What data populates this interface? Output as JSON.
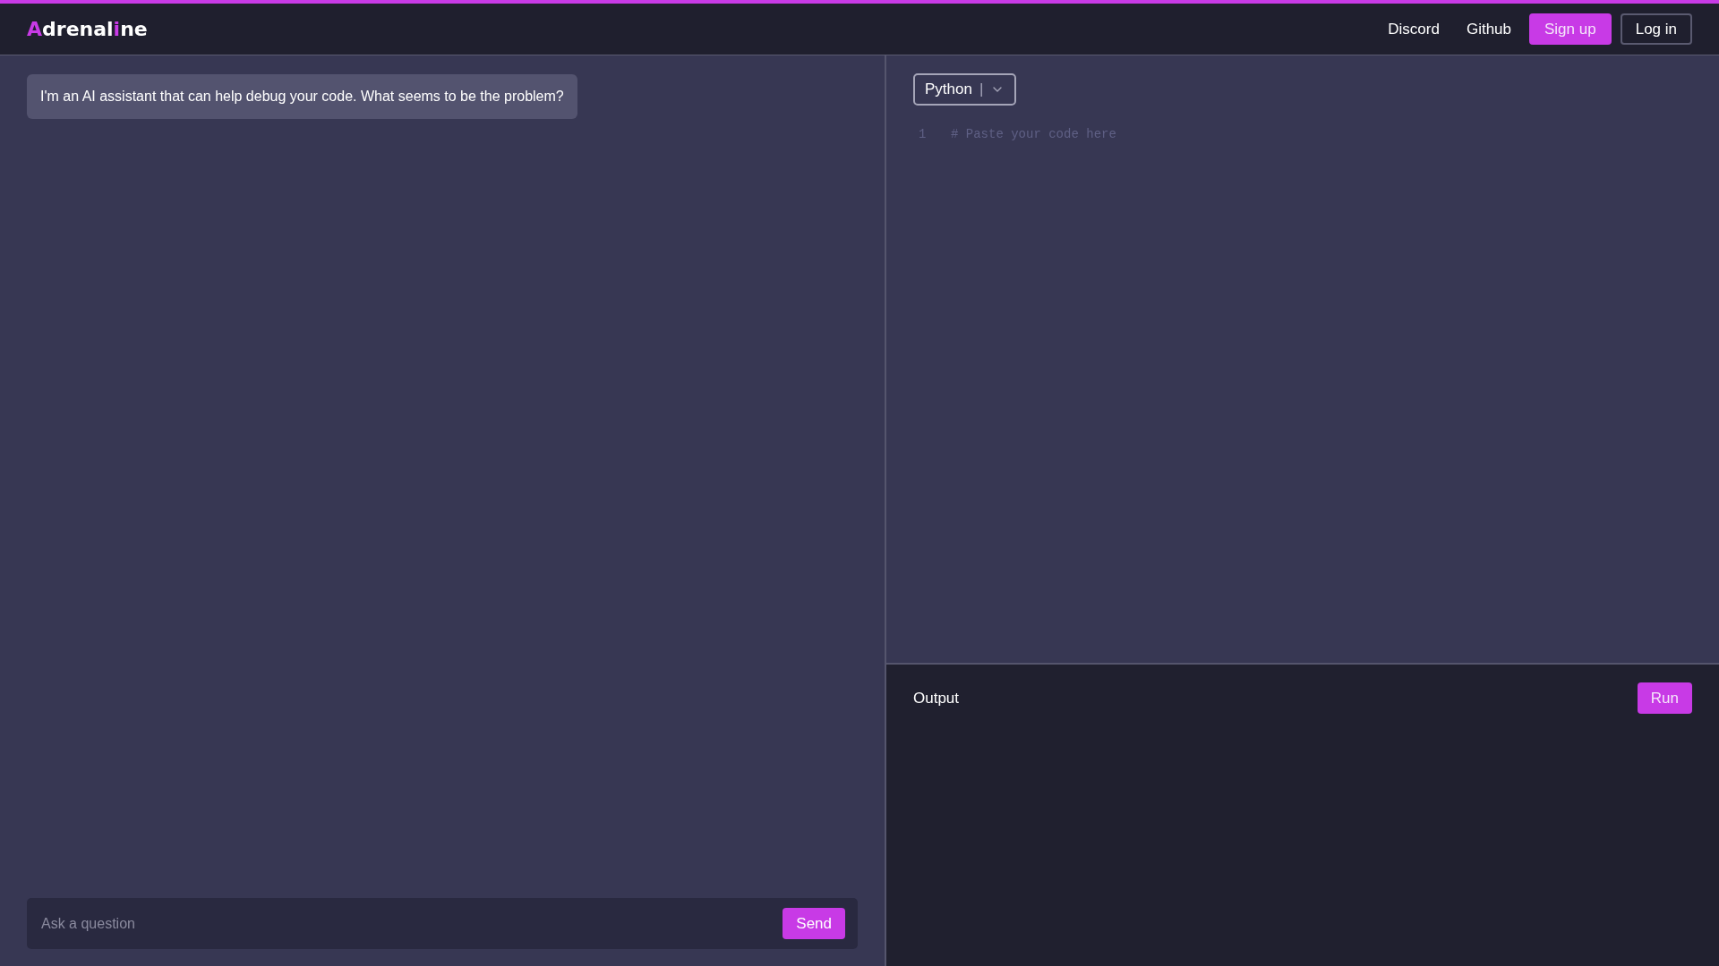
{
  "header": {
    "logo": [
      {
        "text": "A",
        "highlighted": true
      },
      {
        "text": "drenal",
        "highlighted": false
      },
      {
        "text": "i",
        "highlighted": true
      },
      {
        "text": "ne",
        "highlighted": false
      }
    ],
    "links": [
      "Discord",
      "Github"
    ],
    "buttons": [
      {
        "label": "Sign up",
        "kind": "primary"
      },
      {
        "label": "Log in",
        "kind": "outline"
      }
    ]
  },
  "chat": {
    "messages": [
      {
        "text": "I'm an AI assistant that can help debug your code. What seems to be the problem?"
      }
    ],
    "input": {
      "placeholder": "Ask a question"
    },
    "send_button": "Send"
  },
  "editor": {
    "language": "Python",
    "separator": "|",
    "lines": [
      {
        "number": "1",
        "placeholder": "# Paste your code here"
      }
    ]
  },
  "output": {
    "title": "Output",
    "run_button": "Run"
  }
}
